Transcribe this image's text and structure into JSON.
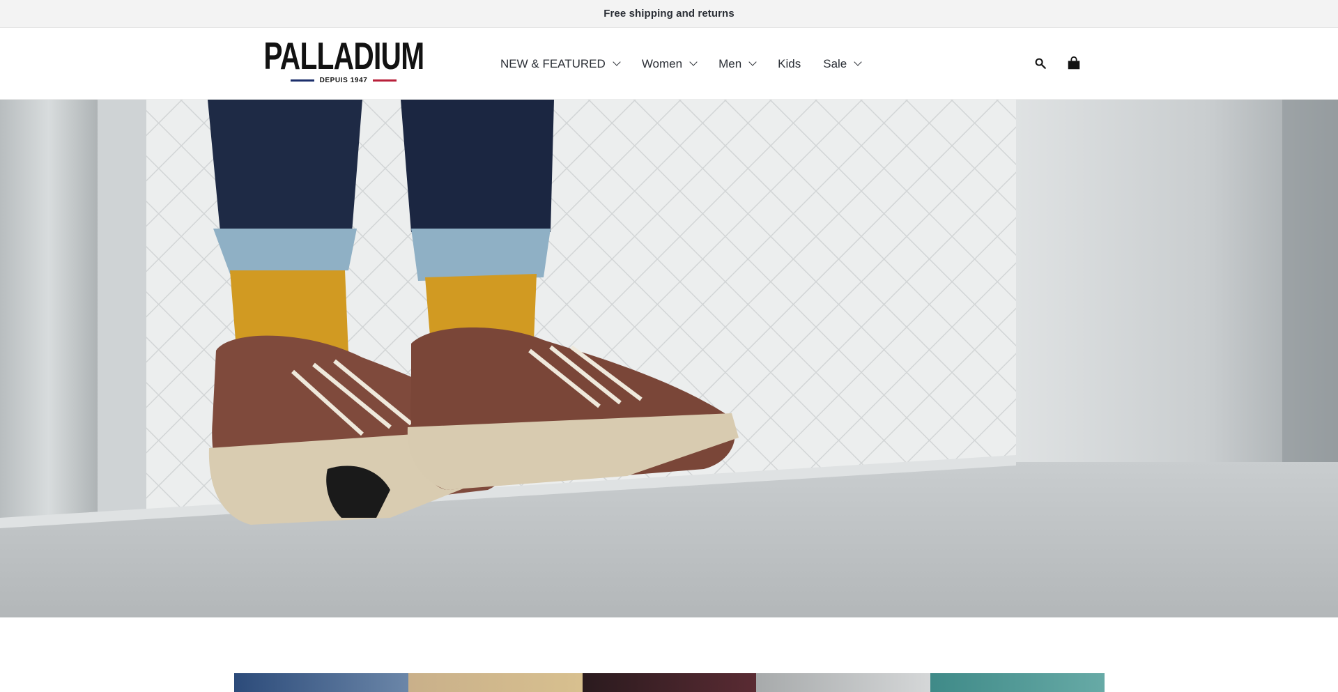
{
  "announcement": {
    "text": "Free shipping and returns"
  },
  "brand": {
    "name": "PALLADIUM",
    "tagline": "DEPUIS 1947"
  },
  "nav": {
    "items": [
      {
        "label": "NEW & FEATURED",
        "has_dropdown": true
      },
      {
        "label": "Women",
        "has_dropdown": true
      },
      {
        "label": "Men",
        "has_dropdown": true
      },
      {
        "label": "Kids",
        "has_dropdown": false
      },
      {
        "label": "Sale",
        "has_dropdown": true
      }
    ]
  },
  "header_icons": {
    "search": "search-icon",
    "cart": "shopping-bag-icon"
  },
  "colors": {
    "announcement_bg": "#f3f3f3",
    "text_dark": "#2b2f36",
    "brand_blue": "#1c2f6b",
    "brand_red": "#b8203a"
  }
}
